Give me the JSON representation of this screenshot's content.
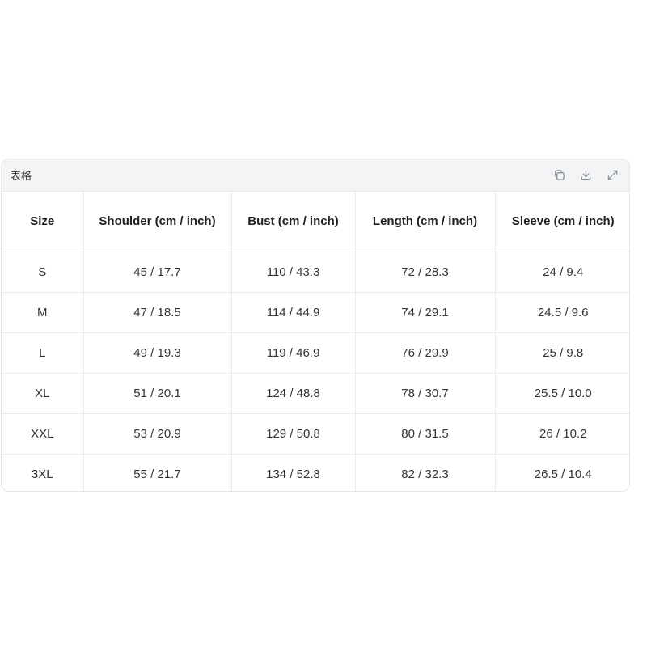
{
  "panel": {
    "title": "表格"
  },
  "icons": {
    "copy": "copy-icon",
    "download": "download-icon",
    "expand": "expand-icon"
  },
  "table": {
    "headers": [
      "Size",
      "Shoulder (cm / inch)",
      "Bust (cm / inch)",
      "Length (cm / inch)",
      "Sleeve (cm / inch)"
    ],
    "rows": [
      [
        "S",
        "45 / 17.7",
        "110 / 43.3",
        "72 / 28.3",
        "24 / 9.4"
      ],
      [
        "M",
        "47 / 18.5",
        "114 / 44.9",
        "74 / 29.1",
        "24.5 / 9.6"
      ],
      [
        "L",
        "49 / 19.3",
        "119 / 46.9",
        "76 / 29.9",
        "25 / 9.8"
      ],
      [
        "XL",
        "51 / 20.1",
        "124 / 48.8",
        "78 / 30.7",
        "25.5 / 10.0"
      ],
      [
        "XXL",
        "53 / 20.9",
        "129 / 50.8",
        "80 / 31.5",
        "26 / 10.2"
      ],
      [
        "3XL",
        "55 / 21.7",
        "134 / 52.8",
        "82 / 32.3",
        "26.5 / 10.4"
      ]
    ]
  }
}
